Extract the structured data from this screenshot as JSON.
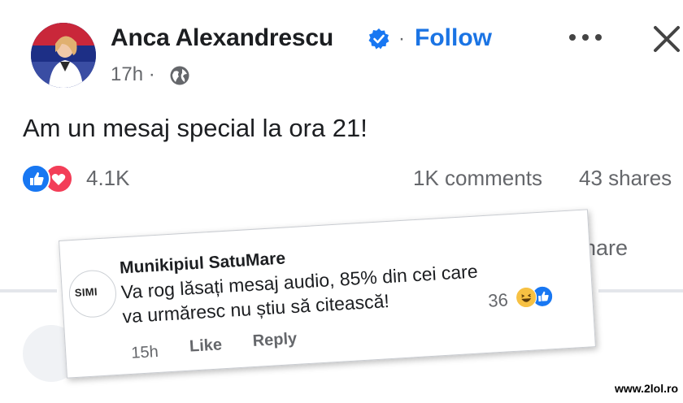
{
  "post": {
    "author_name": "Anca Alexandrescu",
    "separator": "·",
    "follow_label": "Follow",
    "time": "17h ·",
    "text": "Am un mesaj special la ora 21!",
    "reaction_count": "4.1K",
    "comments_count": "1K comments",
    "shares_count": "43 shares",
    "share_action": "hare"
  },
  "icons": {
    "verified": "verified-badge-icon",
    "globe": "globe-icon",
    "more": "more-options-icon",
    "close": "close-icon",
    "like": "like-reaction-icon",
    "love": "love-reaction-icon",
    "haha": "haha-reaction-icon"
  },
  "comment": {
    "avatar_text": "SIMI",
    "author": "Munikipiul SatuMare",
    "line1": "Va rog lăsați mesaj audio, 85% din cei care",
    "line2": "va urmăresc  nu știu să citească!",
    "reaction_count": "36",
    "time": "15h",
    "like_label": "Like",
    "reply_label": "Reply"
  },
  "watermark": "www.2lol.ro",
  "colors": {
    "accent": "#1b74e4",
    "like": "#1877f2",
    "love": "#f33e58",
    "haha": "#f7c143",
    "secondary_text": "#65676b"
  }
}
